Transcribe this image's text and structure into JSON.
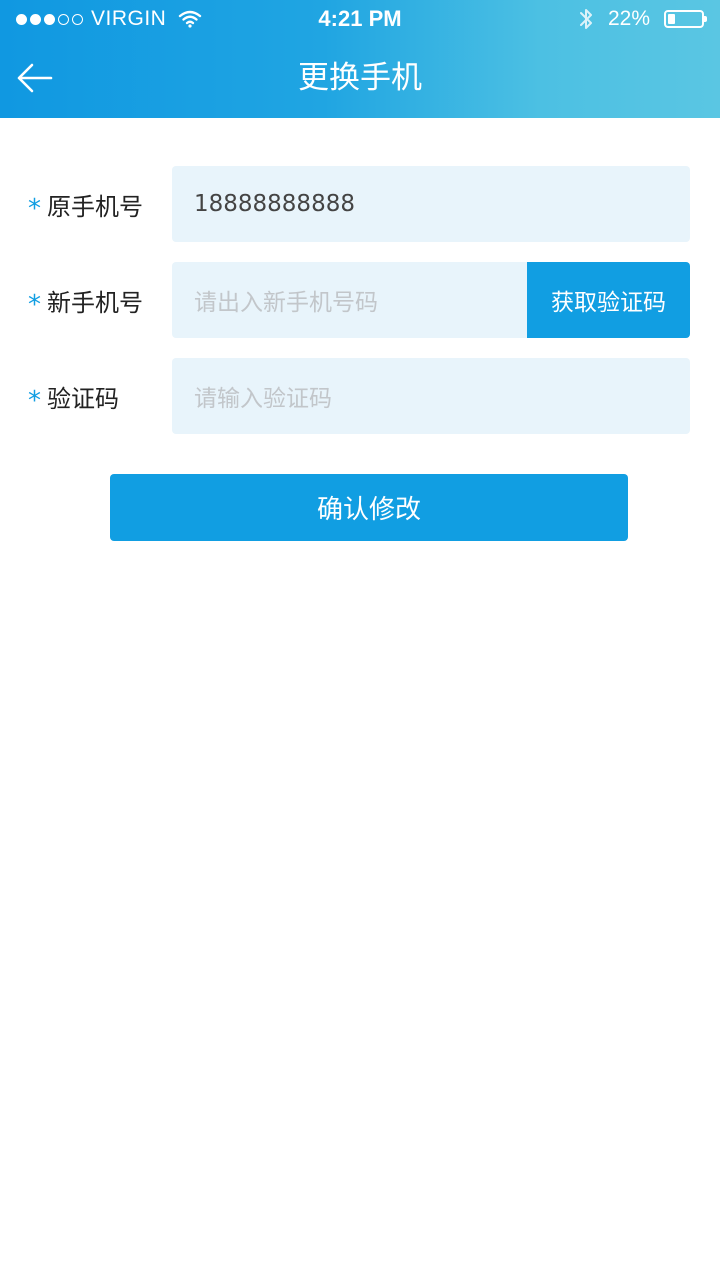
{
  "status_bar": {
    "signal_dots_filled": 3,
    "signal_dots_total": 5,
    "carrier": "VIRGIN",
    "time": "4:21 PM",
    "battery_text": "22%",
    "battery_level": 0.22
  },
  "header": {
    "title": "更换手机",
    "back_icon": "back-arrow-icon"
  },
  "form": {
    "old_phone": {
      "required_mark": "*",
      "label": "原手机号",
      "value": "18888888888"
    },
    "new_phone": {
      "required_mark": "*",
      "label": "新手机号",
      "placeholder": "请出入新手机号码",
      "get_code_label": "获取验证码"
    },
    "verify_code": {
      "required_mark": "*",
      "label": "验证码",
      "placeholder": "请输入验证码"
    },
    "submit_label": "确认修改"
  },
  "colors": {
    "primary": "#119ee2",
    "header_gradient_start": "#1098e1",
    "header_gradient_end": "#5ac6e3",
    "field_background": "#e8f4fb",
    "placeholder_text": "#c2c6ca"
  }
}
